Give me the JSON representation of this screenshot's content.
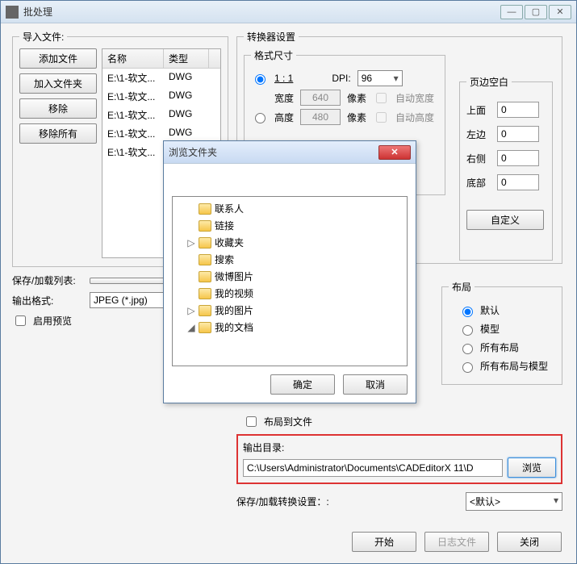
{
  "main": {
    "title": "批处理",
    "import": {
      "legend": "导入文件:",
      "add_file": "添加文件",
      "add_folder": "加入文件夹",
      "remove": "移除",
      "remove_all": "移除所有",
      "cols": {
        "name": "名称",
        "type": "类型"
      },
      "rows": [
        {
          "name": "E:\\1-软文...",
          "type": "DWG"
        },
        {
          "name": "E:\\1-软文...",
          "type": "DWG"
        },
        {
          "name": "E:\\1-软文...",
          "type": "DWG"
        },
        {
          "name": "E:\\1-软文...",
          "type": "DWG"
        },
        {
          "name": "E:\\1-软文...",
          "type": "DWG"
        }
      ]
    },
    "save_load_list_label": "保存/加载列表:",
    "output_format_label": "输出格式:",
    "output_format_value": "JPEG (*.jpg)",
    "enable_preview": "启用预览"
  },
  "converter": {
    "legend": "转换器设置",
    "format_legend": "格式尺寸",
    "ratio_label": "1 : 1",
    "dpi_label": "DPI:",
    "dpi_value": "96",
    "width_label": "宽度",
    "width_value": "640",
    "px1": "像素",
    "auto_width": "自动宽度",
    "height_label": "高度",
    "height_value": "480",
    "px2": "像素",
    "auto_height": "自动高度",
    "px3": "像素",
    "px4": "像素"
  },
  "pageblank": {
    "legend": "页边空白",
    "top": "上面",
    "top_v": "0",
    "left": "左边",
    "left_v": "0",
    "right": "右侧",
    "right_v": "0",
    "bottom": "底部",
    "bottom_v": "0",
    "custom": "自定义"
  },
  "layout": {
    "legend": "布局",
    "default": "默认",
    "model": "模型",
    "all": "所有布局",
    "all_model": "所有布局与模型"
  },
  "output": {
    "layout_to_file": "布局到文件",
    "dir_label": "输出目录:",
    "dir_value": "C:\\Users\\Administrator\\Documents\\CADEditorX 11\\D",
    "browse": "浏览"
  },
  "save_load_conv_label": "保存/加载转换设置：:",
  "save_load_conv_value": "<默认>",
  "bottom": {
    "start": "开始",
    "log": "日志文件",
    "close": "关闭"
  },
  "dlg": {
    "title": "浏览文件夹",
    "items": [
      {
        "exp": "",
        "label": "联系人"
      },
      {
        "exp": "",
        "label": "链接"
      },
      {
        "exp": "▷",
        "label": "收藏夹"
      },
      {
        "exp": "",
        "label": "搜索"
      },
      {
        "exp": "",
        "label": "微博图片"
      },
      {
        "exp": "",
        "label": "我的视频"
      },
      {
        "exp": "▷",
        "label": "我的图片"
      },
      {
        "exp": "◢",
        "label": "我的文档"
      }
    ],
    "ok": "确定",
    "cancel": "取消"
  }
}
